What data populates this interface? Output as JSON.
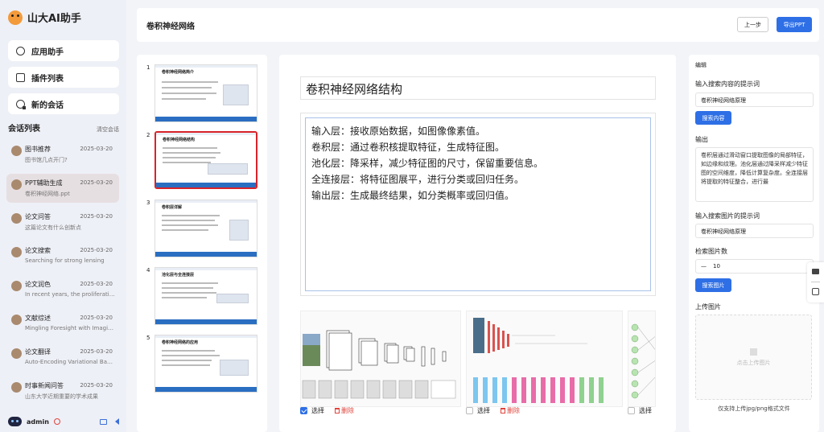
{
  "app": {
    "name": "山大AI助手"
  },
  "nav": [
    {
      "label": "应用助手",
      "icon": "app-assistant-icon"
    },
    {
      "label": "插件列表",
      "icon": "plugin-icon"
    },
    {
      "label": "新的会话",
      "icon": "new-chat-icon"
    }
  ],
  "conversations": {
    "title": "会话列表",
    "clear_label": "清空会话",
    "items": [
      {
        "name": "图书推荐",
        "date": "2025-03-20",
        "subtitle": "图书馆几点开门?"
      },
      {
        "name": "PPT辅助生成",
        "date": "2025-03-20",
        "subtitle": "卷积神经网络.ppt",
        "active": true
      },
      {
        "name": "论文问答",
        "date": "2025-03-20",
        "subtitle": "这篇论文有什么创新点"
      },
      {
        "name": "论文搜索",
        "date": "2025-03-20",
        "subtitle": "Searching for strong lensing"
      },
      {
        "name": "论文润色",
        "date": "2025-03-20",
        "subtitle": "In recent years, the proliferation ..."
      },
      {
        "name": "文献综述",
        "date": "2025-03-20",
        "subtitle": "Mingling Foresight with Imaginat..."
      },
      {
        "name": "论文翻译",
        "date": "2025-03-20",
        "subtitle": "Auto-Encoding Variational Baye..."
      },
      {
        "name": "时事新闻问答",
        "date": "2025-03-20",
        "subtitle": "山东大学近期重要的学术成果"
      }
    ]
  },
  "user": {
    "name": "admin"
  },
  "header": {
    "title": "卷积神经网络",
    "prev_label": "上一步",
    "export_label": "导出PPT"
  },
  "thumbnails": [
    {
      "num": "1",
      "title": "卷积神经网络简介"
    },
    {
      "num": "2",
      "title": "卷积神经网络结构",
      "active": true
    },
    {
      "num": "3",
      "title": "卷积层详解"
    },
    {
      "num": "4",
      "title": "池化层与全连接层"
    },
    {
      "num": "5",
      "title": "卷积神经网络的应用"
    }
  ],
  "slide": {
    "title": "卷积神经网络结构",
    "lines": [
      "输入层：接收原始数据，如图像像素值。",
      "卷积层：通过卷积核提取特征，生成特征图。",
      "池化层：降采样，减少特征图的尺寸，保留重要信息。",
      "全连接层：将特征图展平，进行分类或回归任务。",
      "输出层：生成最终结果，如分类概率或回归值。"
    ],
    "images": [
      {
        "select_label": "选择",
        "delete_label": "删除",
        "selected": true
      },
      {
        "select_label": "选择",
        "delete_label": "删除",
        "selected": false
      },
      {
        "select_label": "选择",
        "selected": false
      }
    ]
  },
  "panel": {
    "section_label": "编辑",
    "search_prompt_label": "输入搜索内容的提示词",
    "search_prompt_value": "卷积神经网络原理",
    "search_button": "搜索内容",
    "output_label": "输出",
    "output_text": "卷积层通过滑动窗口提取图像的局部特征，如边缘和纹理。池化层通过降采样减少特征图的空间维度，降低计算复杂度。全连接层将提取的特征整合，进行最",
    "image_prompt_label": "输入搜索图片的提示词",
    "image_prompt_value": "卷积神经网络原理",
    "count_label": "检索图片数",
    "count_value": "10",
    "image_search_button": "搜索图片",
    "upload_label": "上传图片",
    "upload_placeholder": "点击上传图片",
    "upload_hint": "仅支持上传jpg/png格式文件"
  }
}
